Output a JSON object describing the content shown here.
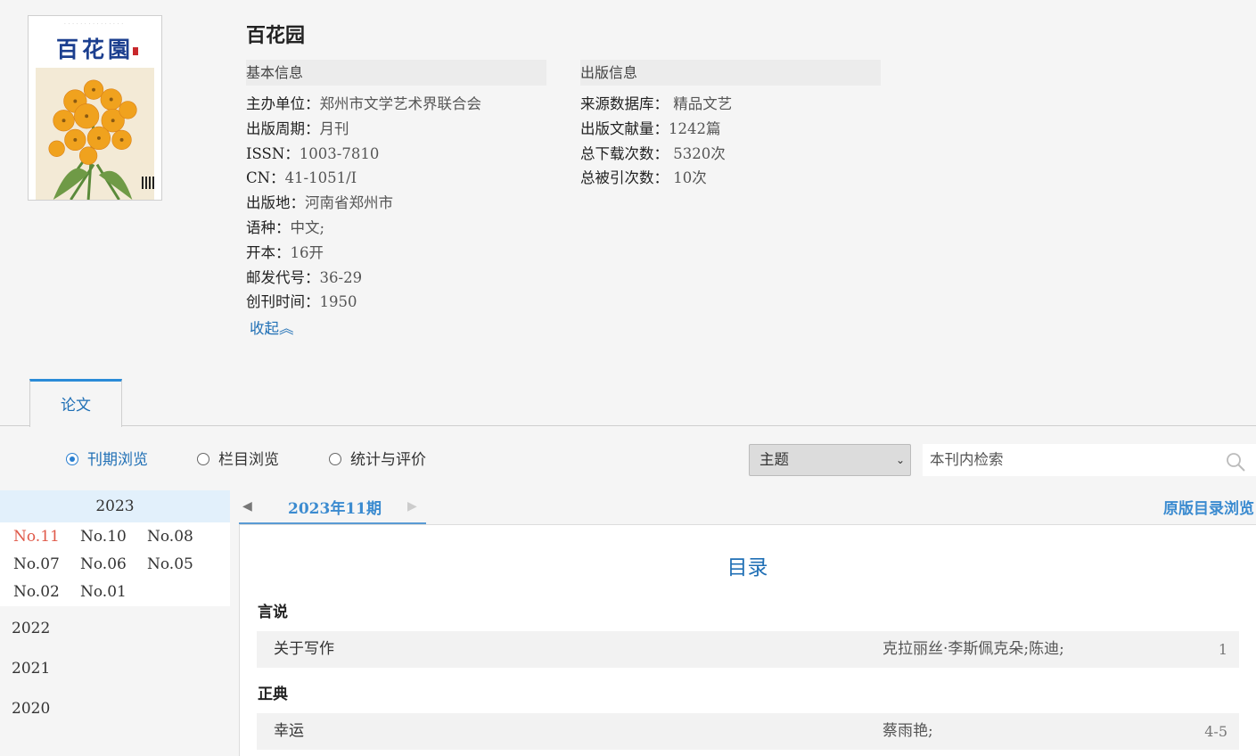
{
  "journal": {
    "title": "百花园",
    "cover_logo": "百花園"
  },
  "basic_info": {
    "heading": "基本信息",
    "items": [
      {
        "label": "主办单位：",
        "value": "郑州市文学艺术界联合会"
      },
      {
        "label": "出版周期：",
        "value": "月刊"
      },
      {
        "label": "ISSN：",
        "value": "1003-7810"
      },
      {
        "label": "CN：",
        "value": "41-1051/I"
      },
      {
        "label": "出版地：",
        "value": "河南省郑州市"
      },
      {
        "label": "语种：",
        "value": "中文;"
      },
      {
        "label": "开本：",
        "value": "16开"
      },
      {
        "label": "邮发代号：",
        "value": "36-29"
      },
      {
        "label": "创刊时间：",
        "value": "1950"
      }
    ],
    "collapse_label": "收起︽"
  },
  "publish_info": {
    "heading": "出版信息",
    "items": [
      {
        "label": "来源数据库：",
        "value": " 精品文艺"
      },
      {
        "label": "出版文献量：",
        "value": "1242篇"
      },
      {
        "label": "总下载次数：",
        "value": " 5320次"
      },
      {
        "label": "总被引次数：",
        "value": " 10次"
      }
    ]
  },
  "tabs": [
    {
      "label": "论文",
      "active": true
    }
  ],
  "browse_modes": [
    {
      "label": "刊期浏览",
      "checked": true
    },
    {
      "label": "栏目浏览",
      "checked": false
    },
    {
      "label": "统计与评价",
      "checked": false
    }
  ],
  "search": {
    "field_selected": "主题",
    "placeholder": "本刊内检索"
  },
  "years": {
    "active": "2023",
    "issues": [
      "No.11",
      "No.10",
      "No.08",
      "No.07",
      "No.06",
      "No.05",
      "No.02",
      "No.01"
    ],
    "current_issue": "No.11",
    "others": [
      "2022",
      "2021",
      "2020"
    ]
  },
  "issue_nav": {
    "current": "2023年11期",
    "prev_arrow": "◀",
    "next_arrow": "▶",
    "orig_toc_label": "原版目录浏览"
  },
  "toc": {
    "heading": "目录",
    "sections": [
      {
        "name": "言说",
        "articles": [
          {
            "title": "关于写作",
            "author": "克拉丽丝·李斯佩克朵;陈迪;",
            "pages": "1"
          }
        ]
      },
      {
        "name": "正典",
        "articles": [
          {
            "title": "幸运",
            "author": "蔡雨艳;",
            "pages": "4-5"
          }
        ]
      }
    ]
  },
  "colors": {
    "accent": "#1f6fb5",
    "link_blue": "#3b8bd0",
    "current_issue": "#e05a4a",
    "active_year_bg": "#e2f0fb"
  }
}
